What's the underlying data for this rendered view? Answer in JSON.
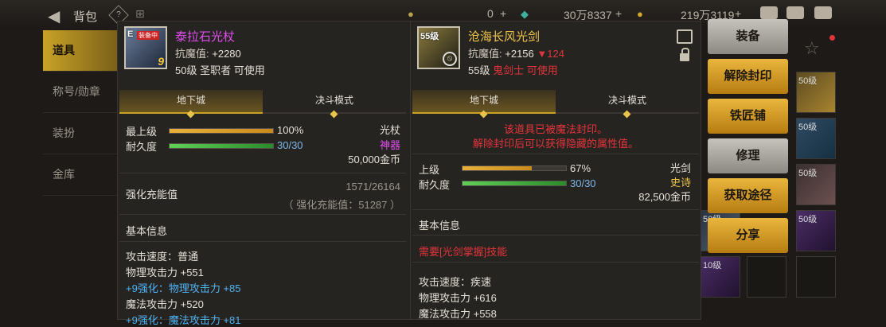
{
  "topbar": {
    "title": "背包",
    "currency1": "0",
    "currency2": "30万8337",
    "currency3": "219万3119",
    "plus": "+"
  },
  "left_tabs": [
    "道具",
    "称号/勋章",
    "装扮",
    "金库"
  ],
  "item1": {
    "name": "泰拉石光杖",
    "resist_label": "抗魔值:",
    "resist_value": "+2280",
    "level_req": "50级",
    "class_req": "圣职者 可使用",
    "stack_count": "9",
    "icon_badge": "装备中",
    "icon_level": "E",
    "tabs": [
      "地下城",
      "决斗模式"
    ],
    "upper_label": "最上级",
    "upper_pct_text": "100%",
    "upper_pct": 100,
    "durability_label": "耐久度",
    "durability_text": "30/30",
    "durability_pct": 100,
    "type": "光杖",
    "rarity": "神器",
    "price": "50,000金币",
    "charge_label": "强化充能值",
    "charge_value": "1571/26164",
    "charge_sub": "（ 强化充能值：51287 ）",
    "basic_info": "基本信息",
    "stats": [
      {
        "text": "攻击速度：普通",
        "color": "normal"
      },
      {
        "text": "物理攻击力 +551",
        "color": "normal"
      },
      {
        "text": "+9强化：物理攻击力 +85",
        "color": "blue"
      },
      {
        "text": "魔法攻击力 +520",
        "color": "normal"
      },
      {
        "text": "+9强化：魔法攻击力 +81",
        "color": "blue"
      }
    ]
  },
  "item2": {
    "name": "沧海长风光剑",
    "resist_label": "抗魔值:",
    "resist_value": "+2156",
    "resist_diff": "▼124",
    "level_req": "55级",
    "class_req": "鬼剑士 可使用",
    "icon_level": "55级",
    "tabs": [
      "地下城",
      "决斗模式"
    ],
    "seal_line1": "该道具已被魔法封印。",
    "seal_line2": "解除封印后可以获得隐藏的属性值。",
    "upper_label": "上级",
    "upper_pct_text": "67%",
    "upper_pct": 67,
    "durability_label": "耐久度",
    "durability_text": "30/30",
    "durability_pct": 100,
    "type": "光剑",
    "rarity": "史诗",
    "price": "82,500金币",
    "basic_info": "基本信息",
    "skill_req": "需要[光剑掌握]技能",
    "stats": [
      {
        "text": "攻击速度：疾速",
        "color": "normal"
      },
      {
        "text": "物理攻击力 +616",
        "color": "normal"
      },
      {
        "text": "魔法攻击力 +558",
        "color": "normal"
      }
    ]
  },
  "actions": [
    {
      "label": "装备",
      "style": "gray"
    },
    {
      "label": "解除封印",
      "style": "gold"
    },
    {
      "label": "铁匠铺",
      "style": "gold"
    },
    {
      "label": "修理",
      "style": "gray"
    },
    {
      "label": "获取途径",
      "style": "gold"
    },
    {
      "label": "分享",
      "style": "gold"
    }
  ],
  "inventory_slots": [
    {
      "label": "50级",
      "style": "s-img1"
    },
    {
      "label": "50级",
      "style": "s-img2"
    },
    {
      "label": "50级",
      "style": "s-img3"
    },
    {
      "label": "50级",
      "style": "s-img4"
    },
    {
      "label": "50级",
      "style": "s-img5"
    },
    {
      "label": "10级",
      "style": "s-img4"
    }
  ]
}
